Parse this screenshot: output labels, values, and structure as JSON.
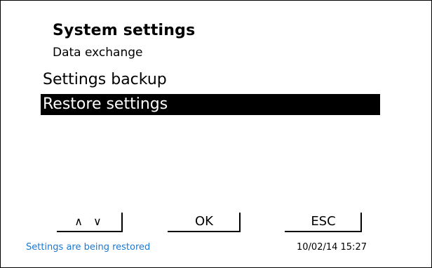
{
  "header": {
    "title": "System settings",
    "subtitle": "Data exchange"
  },
  "menu": {
    "items": [
      {
        "label": "Settings backup",
        "selected": false
      },
      {
        "label": "Restore settings",
        "selected": true
      }
    ]
  },
  "softkeys": {
    "nav_label": "∧ ∨",
    "ok_label": "OK",
    "esc_label": "ESC"
  },
  "statusbar": {
    "message": "Settings are being restored",
    "message_color": "#1a78d6",
    "datetime": "10/02/14 15:27"
  }
}
